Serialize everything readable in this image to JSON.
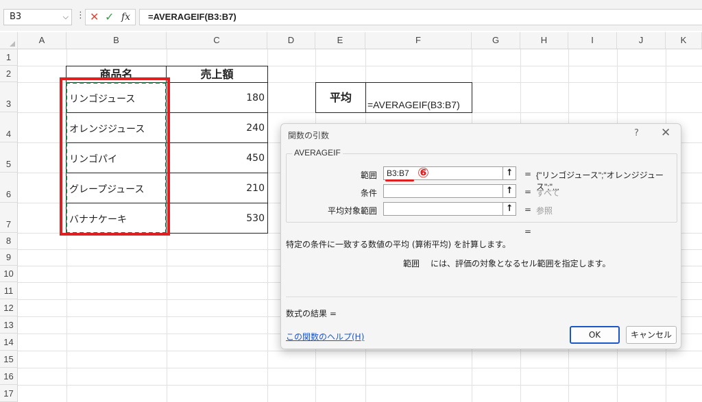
{
  "formula_bar": {
    "name_box": "B3",
    "name_box_chev": "⌵",
    "dots": "⋮",
    "cancel_glyph": "✕",
    "enter_glyph": "✓",
    "fx_label": "fx",
    "formula": "=AVERAGEIF(B3:B7)"
  },
  "columns": [
    "A",
    "B",
    "C",
    "D",
    "E",
    "F",
    "G",
    "H",
    "I",
    "J",
    "K"
  ],
  "rows": [
    "1",
    "2",
    "3",
    "4",
    "5",
    "6",
    "7",
    "8",
    "9",
    "10",
    "11",
    "12",
    "13",
    "14",
    "15",
    "16",
    "17"
  ],
  "table": {
    "headers": [
      "商品名",
      "売上額"
    ],
    "rows": [
      {
        "name": "リンゴジュース",
        "value": "180"
      },
      {
        "name": "オレンジジュース",
        "value": "240"
      },
      {
        "name": "リンゴパイ",
        "value": "450"
      },
      {
        "name": "グレープジュース",
        "value": "210"
      },
      {
        "name": "バナナケーキ",
        "value": "530"
      }
    ]
  },
  "avg_box": {
    "label": "平均",
    "formula": "=AVERAGEIF(B3:B7)"
  },
  "dialog": {
    "title": "関数の引数",
    "help_glyph": "?",
    "close_glyph": "✕",
    "function_name": "AVERAGEIF",
    "args": [
      {
        "label": "範囲",
        "value": "B3:B7",
        "result": "{\"リンゴジュース\";\"オレンジジュース\";\"..."
      },
      {
        "label": "条件",
        "value": "",
        "result": "すべて"
      },
      {
        "label": "平均対象範囲",
        "value": "",
        "result": "参照"
      }
    ],
    "ref_glyph": "⭡",
    "equals": "=",
    "description": "特定の条件に一致する数値の平均 (算術平均) を計算します。",
    "arg_help_name": "範囲",
    "arg_help_text": "には、評価の対象となるセル範囲を指定します。",
    "formula_result_label": "数式の結果 =",
    "help_link": "この関数のヘルプ(H)",
    "ok_label": "OK",
    "cancel_label": "キャンセル"
  },
  "annotation": {
    "step_number": "⑥"
  },
  "colors": {
    "highlight_red": "#e02020",
    "marching_green": "#217346",
    "link_blue": "#1a56c8"
  }
}
